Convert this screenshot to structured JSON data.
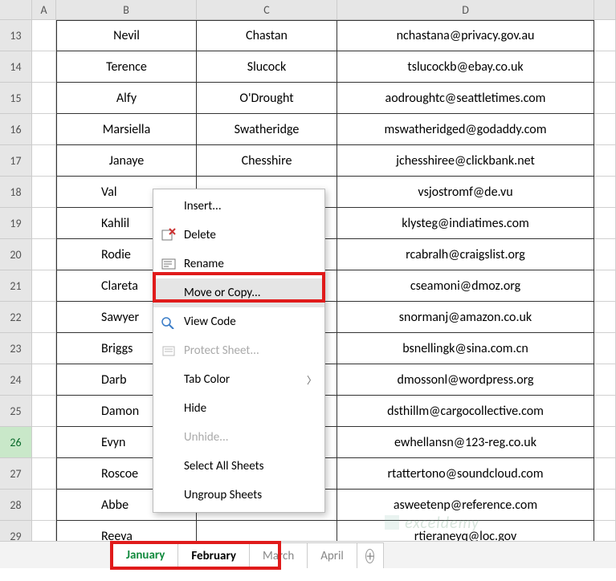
{
  "columns": [
    "A",
    "B",
    "C",
    "D"
  ],
  "rows": [
    {
      "n": 13,
      "b": "Nevil",
      "c": "Chastan",
      "d": "nchastana@privacy.gov.au"
    },
    {
      "n": 14,
      "b": "Terence",
      "c": "Slucock",
      "d": "tslucockb@ebay.co.uk"
    },
    {
      "n": 15,
      "b": "Alfy",
      "c": "O'Drought",
      "d": "aodroughtc@seattletimes.com"
    },
    {
      "n": 16,
      "b": "Marsiella",
      "c": "Swatheridge",
      "d": "mswatheridged@godaddy.com"
    },
    {
      "n": 17,
      "b": "Janaye",
      "c": "Chesshire",
      "d": "jchesshiree@clickbank.net"
    },
    {
      "n": 18,
      "b": "Val",
      "c": "",
      "d": "vsjostromf@de.vu"
    },
    {
      "n": 19,
      "b": "Kahlil",
      "c": "",
      "d": "klysteg@indiatimes.com"
    },
    {
      "n": 20,
      "b": "Rodie",
      "c": "",
      "d": "rcabralh@craigslist.org"
    },
    {
      "n": 21,
      "b": "Clareta",
      "c": "",
      "d": "cseamoni@dmoz.org"
    },
    {
      "n": 22,
      "b": "Sawyer",
      "c": "",
      "d": "snormanj@amazon.co.uk"
    },
    {
      "n": 23,
      "b": "Briggs",
      "c": "",
      "d": "bsnellingk@sina.com.cn"
    },
    {
      "n": 24,
      "b": "Darb",
      "c": "",
      "d": "dmossonl@wordpress.org"
    },
    {
      "n": 25,
      "b": "Damon",
      "c": "",
      "d": "dsthillm@cargocollective.com"
    },
    {
      "n": 26,
      "b": "Evyn",
      "c": "",
      "d": "ewhellansn@123-reg.co.uk"
    },
    {
      "n": 27,
      "b": "Roscoe",
      "c": "",
      "d": "rtattertono@soundcloud.com"
    },
    {
      "n": 28,
      "b": "Abbe",
      "c": "",
      "d": "asweetenp@reference.com"
    },
    {
      "n": 29,
      "b": "Reeva",
      "c": "",
      "d": "rtieraneyq@loc.gov"
    }
  ],
  "selected_row": 26,
  "context_menu": {
    "insert": "Insert...",
    "delete": "Delete",
    "rename": "Rename",
    "move": "Move or Copy...",
    "viewcode": "View Code",
    "protect": "Protect Sheet...",
    "tabcolor": "Tab Color",
    "hide": "Hide",
    "unhide": "Unhide...",
    "selectall": "Select All Sheets",
    "ungroup": "Ungroup Sheets"
  },
  "tabs": [
    "January",
    "February",
    "March",
    "April"
  ],
  "active_tab": "January",
  "selected_tabs": [
    "January",
    "February"
  ],
  "watermark": "exceldemy"
}
